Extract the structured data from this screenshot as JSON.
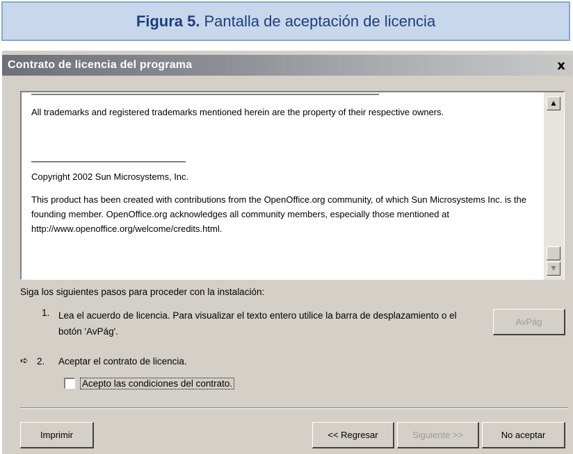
{
  "caption": {
    "label": "Figura 5.",
    "text": "Pantalla de aceptación de licencia"
  },
  "window": {
    "title": "Contrato de licencia del programa",
    "close_glyph": "x"
  },
  "license": {
    "paragraph_trademarks": "All trademarks and registered trademarks mentioned herein are the property of their respective owners.",
    "paragraph_copyright": "Copyright 2002 Sun Microsystems, Inc.",
    "paragraph_product": "This product has been created with contributions from the OpenOffice.org community, of which Sun Microsystems Inc. is the founding member. OpenOffice.org acknowledges all community members, especially those mentioned at http://www.openoffice.org/welcome/credits.html."
  },
  "scrollbar": {
    "up_glyph": "▲",
    "down_glyph": "▼"
  },
  "instructions": {
    "intro": "Siga los siguientes pasos para proceder con la instalación:",
    "step1_number": "1.",
    "step1_text": "Lea el acuerdo de licencia. Para visualizar el texto entero utilice la barra de desplazamiento o el botón 'AvPág'.",
    "step2_arrow": "➪",
    "step2_number": "2.",
    "step2_text": "Aceptar el contrato de licencia.",
    "checkbox_label": "Acepto las condiciones del contrato.",
    "checkbox_checked": false
  },
  "buttons": {
    "avpag": "AvPág",
    "imprimir": "Imprimir",
    "regresar": "<< Regresar",
    "siguiente": "Siguiente >>",
    "no_aceptar": "No aceptar"
  }
}
